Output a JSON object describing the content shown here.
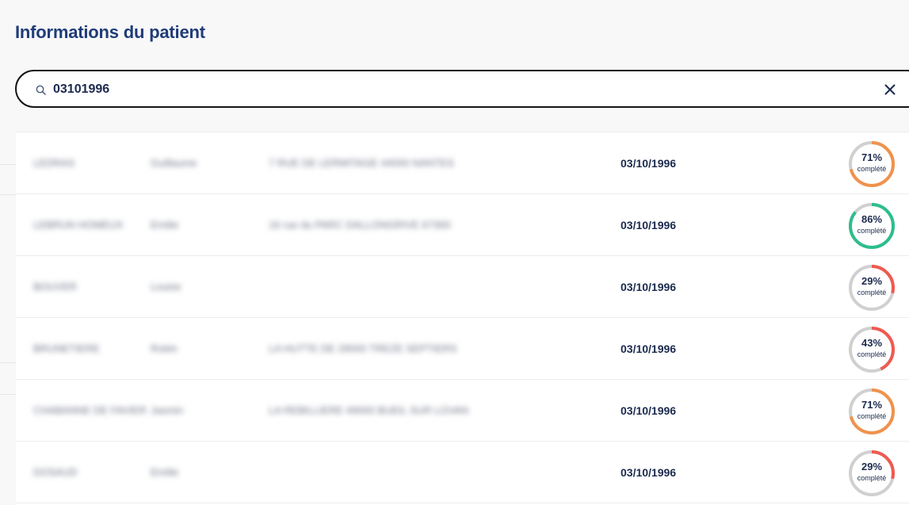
{
  "page": {
    "title": "Informations du patient"
  },
  "search": {
    "value": "03101996",
    "icon": "search-icon",
    "clear_icon": "close-icon"
  },
  "colors": {
    "title": "#1f3c78",
    "orange": "#f0924c",
    "green": "#2dbe8c",
    "red": "#ef5a50",
    "track": "#d0d0d0"
  },
  "results": [
    {
      "last_name": "LEDRAS",
      "first_name": "Guillaume",
      "address": "7 RUE DE LERMITAGE 44000 NANTES",
      "birth_date": "03/10/1996",
      "completion": 71,
      "completion_label": "71%",
      "status_label": "complété",
      "color": "#f0924c"
    },
    {
      "last_name": "LEBRUN HOMEUX",
      "first_name": "Emilie",
      "address": "16 rue du PARC DALLONGRIVE 67300",
      "birth_date": "03/10/1996",
      "completion": 86,
      "completion_label": "86%",
      "status_label": "complété",
      "color": "#2dbe8c"
    },
    {
      "last_name": "BOUVER",
      "first_name": "Louise",
      "address": "",
      "birth_date": "03/10/1996",
      "completion": 29,
      "completion_label": "29%",
      "status_label": "complété",
      "color": "#ef5a50"
    },
    {
      "last_name": "BRUNETIERE",
      "first_name": "Robin",
      "address": "LA HUTTE DE 29000 TREZE SEPTIERS",
      "birth_date": "03/10/1996",
      "completion": 43,
      "completion_label": "43%",
      "status_label": "complété",
      "color": "#ef5a50"
    },
    {
      "last_name": "CHABANNE DE FAVIER",
      "first_name": "Jasmin",
      "address": "LA REBILLIERE 49000 BUEIL SUR LOVAN",
      "birth_date": "03/10/1996",
      "completion": 71,
      "completion_label": "71%",
      "status_label": "complété",
      "color": "#f0924c"
    },
    {
      "last_name": "DOSAUD",
      "first_name": "Emilie",
      "address": "",
      "birth_date": "03/10/1996",
      "completion": 29,
      "completion_label": "29%",
      "status_label": "complété",
      "color": "#ef5a50"
    }
  ]
}
